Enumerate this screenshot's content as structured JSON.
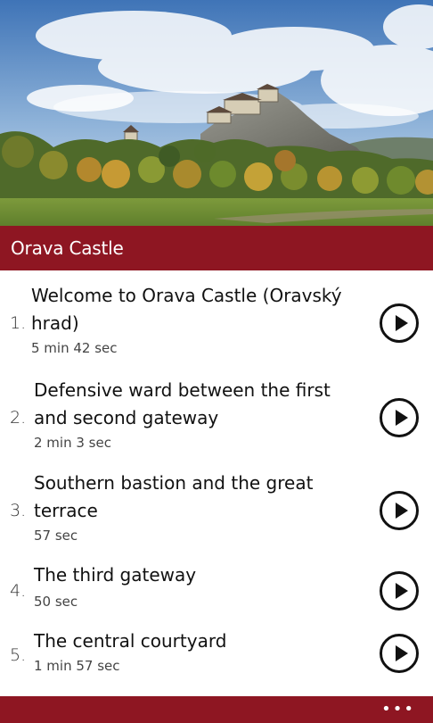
{
  "hero": {
    "image_name": "orava-castle-photo"
  },
  "header": {
    "title": "Orava Castle"
  },
  "tracks": [
    {
      "number": "1.",
      "title": "Welcome to Orava Castle (Oravský hrad)",
      "duration": "5 min 42 sec",
      "icon": "play-icon"
    },
    {
      "number": "2.",
      "title": "Defensive ward between the first and second gateway",
      "duration": "2 min 3 sec",
      "icon": "play-icon"
    },
    {
      "number": "3.",
      "title": "Southern bastion and the great terrace",
      "duration": "57 sec",
      "icon": "play-icon"
    },
    {
      "number": "4.",
      "title": "The third gateway",
      "duration": "50 sec",
      "icon": "play-icon"
    },
    {
      "number": "5.",
      "title": "The central courtyard",
      "duration": "1 min 57 sec",
      "icon": "play-icon"
    }
  ],
  "app_bar": {
    "more_label": "•••"
  },
  "colors": {
    "accent": "#8e1622",
    "text": "#111111",
    "background": "#ffffff"
  }
}
